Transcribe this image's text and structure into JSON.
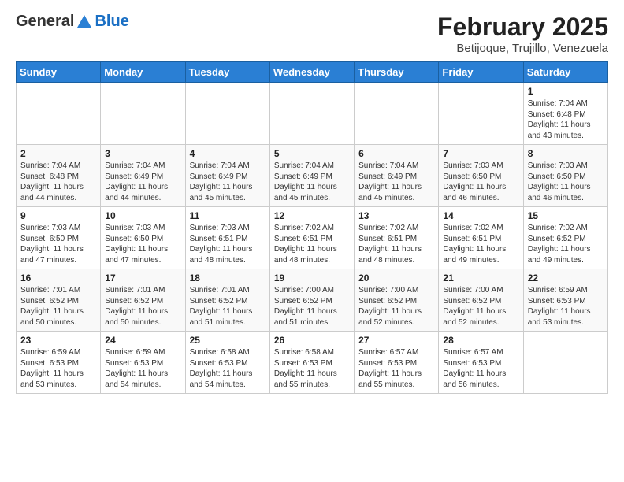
{
  "header": {
    "logo_general": "General",
    "logo_blue": "Blue",
    "month_year": "February 2025",
    "location": "Betijoque, Trujillo, Venezuela"
  },
  "weekdays": [
    "Sunday",
    "Monday",
    "Tuesday",
    "Wednesday",
    "Thursday",
    "Friday",
    "Saturday"
  ],
  "weeks": [
    [
      {
        "day": "",
        "info": ""
      },
      {
        "day": "",
        "info": ""
      },
      {
        "day": "",
        "info": ""
      },
      {
        "day": "",
        "info": ""
      },
      {
        "day": "",
        "info": ""
      },
      {
        "day": "",
        "info": ""
      },
      {
        "day": "1",
        "info": "Sunrise: 7:04 AM\nSunset: 6:48 PM\nDaylight: 11 hours\nand 43 minutes."
      }
    ],
    [
      {
        "day": "2",
        "info": "Sunrise: 7:04 AM\nSunset: 6:48 PM\nDaylight: 11 hours\nand 44 minutes."
      },
      {
        "day": "3",
        "info": "Sunrise: 7:04 AM\nSunset: 6:49 PM\nDaylight: 11 hours\nand 44 minutes."
      },
      {
        "day": "4",
        "info": "Sunrise: 7:04 AM\nSunset: 6:49 PM\nDaylight: 11 hours\nand 45 minutes."
      },
      {
        "day": "5",
        "info": "Sunrise: 7:04 AM\nSunset: 6:49 PM\nDaylight: 11 hours\nand 45 minutes."
      },
      {
        "day": "6",
        "info": "Sunrise: 7:04 AM\nSunset: 6:49 PM\nDaylight: 11 hours\nand 45 minutes."
      },
      {
        "day": "7",
        "info": "Sunrise: 7:03 AM\nSunset: 6:50 PM\nDaylight: 11 hours\nand 46 minutes."
      },
      {
        "day": "8",
        "info": "Sunrise: 7:03 AM\nSunset: 6:50 PM\nDaylight: 11 hours\nand 46 minutes."
      }
    ],
    [
      {
        "day": "9",
        "info": "Sunrise: 7:03 AM\nSunset: 6:50 PM\nDaylight: 11 hours\nand 47 minutes."
      },
      {
        "day": "10",
        "info": "Sunrise: 7:03 AM\nSunset: 6:50 PM\nDaylight: 11 hours\nand 47 minutes."
      },
      {
        "day": "11",
        "info": "Sunrise: 7:03 AM\nSunset: 6:51 PM\nDaylight: 11 hours\nand 48 minutes."
      },
      {
        "day": "12",
        "info": "Sunrise: 7:02 AM\nSunset: 6:51 PM\nDaylight: 11 hours\nand 48 minutes."
      },
      {
        "day": "13",
        "info": "Sunrise: 7:02 AM\nSunset: 6:51 PM\nDaylight: 11 hours\nand 48 minutes."
      },
      {
        "day": "14",
        "info": "Sunrise: 7:02 AM\nSunset: 6:51 PM\nDaylight: 11 hours\nand 49 minutes."
      },
      {
        "day": "15",
        "info": "Sunrise: 7:02 AM\nSunset: 6:52 PM\nDaylight: 11 hours\nand 49 minutes."
      }
    ],
    [
      {
        "day": "16",
        "info": "Sunrise: 7:01 AM\nSunset: 6:52 PM\nDaylight: 11 hours\nand 50 minutes."
      },
      {
        "day": "17",
        "info": "Sunrise: 7:01 AM\nSunset: 6:52 PM\nDaylight: 11 hours\nand 50 minutes."
      },
      {
        "day": "18",
        "info": "Sunrise: 7:01 AM\nSunset: 6:52 PM\nDaylight: 11 hours\nand 51 minutes."
      },
      {
        "day": "19",
        "info": "Sunrise: 7:00 AM\nSunset: 6:52 PM\nDaylight: 11 hours\nand 51 minutes."
      },
      {
        "day": "20",
        "info": "Sunrise: 7:00 AM\nSunset: 6:52 PM\nDaylight: 11 hours\nand 52 minutes."
      },
      {
        "day": "21",
        "info": "Sunrise: 7:00 AM\nSunset: 6:52 PM\nDaylight: 11 hours\nand 52 minutes."
      },
      {
        "day": "22",
        "info": "Sunrise: 6:59 AM\nSunset: 6:53 PM\nDaylight: 11 hours\nand 53 minutes."
      }
    ],
    [
      {
        "day": "23",
        "info": "Sunrise: 6:59 AM\nSunset: 6:53 PM\nDaylight: 11 hours\nand 53 minutes."
      },
      {
        "day": "24",
        "info": "Sunrise: 6:59 AM\nSunset: 6:53 PM\nDaylight: 11 hours\nand 54 minutes."
      },
      {
        "day": "25",
        "info": "Sunrise: 6:58 AM\nSunset: 6:53 PM\nDaylight: 11 hours\nand 54 minutes."
      },
      {
        "day": "26",
        "info": "Sunrise: 6:58 AM\nSunset: 6:53 PM\nDaylight: 11 hours\nand 55 minutes."
      },
      {
        "day": "27",
        "info": "Sunrise: 6:57 AM\nSunset: 6:53 PM\nDaylight: 11 hours\nand 55 minutes."
      },
      {
        "day": "28",
        "info": "Sunrise: 6:57 AM\nSunset: 6:53 PM\nDaylight: 11 hours\nand 56 minutes."
      },
      {
        "day": "",
        "info": ""
      }
    ]
  ]
}
